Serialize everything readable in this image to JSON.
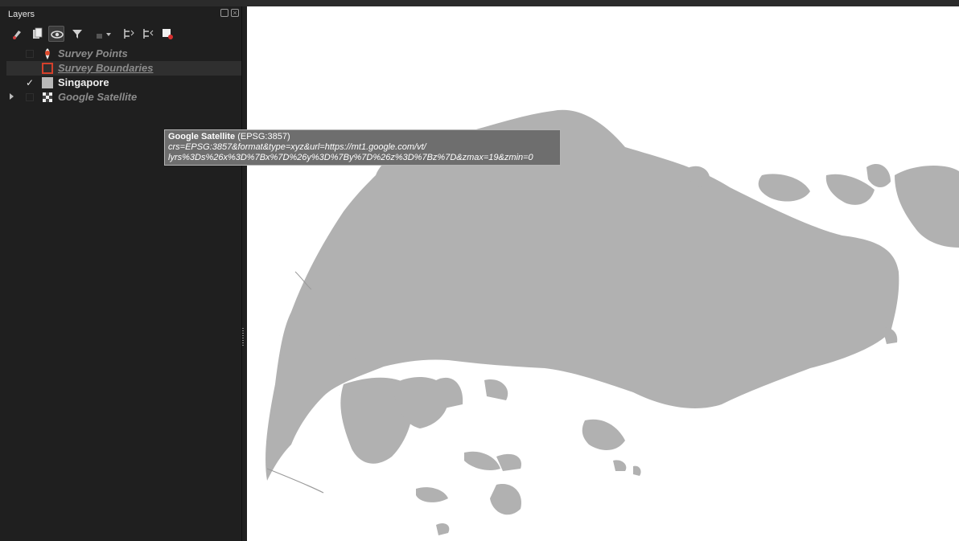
{
  "panel": {
    "title": "Layers"
  },
  "toolbar": {
    "items": [
      {
        "icon": "style-paint-icon"
      },
      {
        "icon": "add-group-icon"
      },
      {
        "icon": "visibility-eye-icon"
      },
      {
        "icon": "filter-icon"
      },
      {
        "icon": "filter-expression-icon"
      },
      {
        "icon": "expand-all-icon"
      },
      {
        "icon": "collapse-all-icon"
      },
      {
        "icon": "remove-layer-icon"
      }
    ]
  },
  "layers": [
    {
      "name": "Survey Points",
      "checked": false,
      "icon": "point-layer-icon"
    },
    {
      "name": "Survey Boundaries",
      "checked": false,
      "icon": "polygon-layer-icon"
    },
    {
      "name": "Singapore",
      "checked": true,
      "check_glyph": "✓",
      "icon": "polygon-fill-icon"
    },
    {
      "name": "Google Satellite",
      "checked": false,
      "icon": "raster-layer-icon"
    }
  ],
  "tooltip": {
    "layer_name": "Google Satellite",
    "crs": "(EPSG:3857)",
    "line2": "crs=EPSG:3857&format&type=xyz&url=https://mt1.google.com/vt/",
    "line3": "lyrs%3Ds%26x%3D%7Bx%7D%26y%3D%7By%7D%26z%3D%7Bz%7D&zmax=19&zmin=0"
  },
  "colors": {
    "land": "#b1b1b1",
    "panel_bg": "#1f1f1f",
    "map_bg": "#ffffff"
  }
}
